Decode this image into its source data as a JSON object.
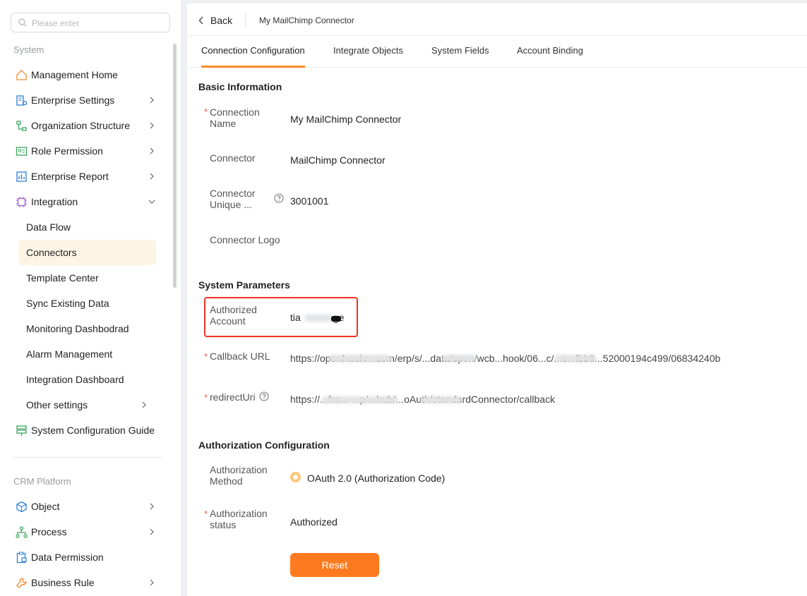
{
  "sidebar": {
    "search_placeholder": "Please enter",
    "system_label": "System",
    "crm_label": "CRM Platform",
    "items": [
      {
        "label": "Management Home"
      },
      {
        "label": "Enterprise Settings"
      },
      {
        "label": "Organization Structure"
      },
      {
        "label": "Role Permission"
      },
      {
        "label": "Enterprise Report"
      },
      {
        "label": "Integration"
      }
    ],
    "integration_sub": [
      {
        "label": "Data Flow"
      },
      {
        "label": "Connectors"
      },
      {
        "label": "Template Center"
      },
      {
        "label": "Sync Existing Data"
      },
      {
        "label": "Monitoring Dashbodrad"
      },
      {
        "label": "Alarm Management"
      },
      {
        "label": "Integration Dashboard"
      },
      {
        "label": "Other settings"
      }
    ],
    "guide": {
      "label": "System Configuration Guide"
    },
    "crm_items": [
      {
        "label": "Object"
      },
      {
        "label": "Process"
      },
      {
        "label": "Data Permission"
      },
      {
        "label": "Business Rule"
      }
    ]
  },
  "header": {
    "back_label": "Back",
    "breadcrumb": "My MailChimp Connector"
  },
  "tabs": [
    {
      "label": "Connection Configuration"
    },
    {
      "label": "Integrate Objects"
    },
    {
      "label": "System Fields"
    },
    {
      "label": "Account Binding"
    }
  ],
  "basic": {
    "title": "Basic Information",
    "name_label_1": "Connection",
    "name_label_2": "Name",
    "name_value": "My MailChimp Connector",
    "connector_label": "Connector",
    "connector_value": "MailChimp Connector",
    "unique_label_1": "Connector",
    "unique_label_2": "Unique ...",
    "unique_value": "3001001",
    "logo_label": "Connector Logo"
  },
  "params": {
    "title": "System Parameters",
    "account_label_1": "Authorized",
    "account_label_2": "Account",
    "account_value_start": "tia",
    "account_value_end": "ge",
    "callback_label": "Callback URL",
    "callback_value": "https://openfxcshr...com/erp/s/...data/open/wcb...hook/06...c/...c...fbb0...52000194c499/06834240b",
    "redirect_label": "redirectUri",
    "redirect_value": "https://...fxs...  ...p/...hub/...oAuth/standardConnector/callback"
  },
  "auth": {
    "title": "Authorization Configuration",
    "method_label_1": "Authorization",
    "method_label_2": "Method",
    "method_value": "OAuth 2.0 (Authorization Code)",
    "status_label_1": "Authorization",
    "status_label_2": "status",
    "status_value": "Authorized",
    "reset_label": "Reset"
  },
  "colors": {
    "accent": "#ff7a1f",
    "active_bg": "#fdf4e6",
    "highlight_border": "#f03325"
  }
}
